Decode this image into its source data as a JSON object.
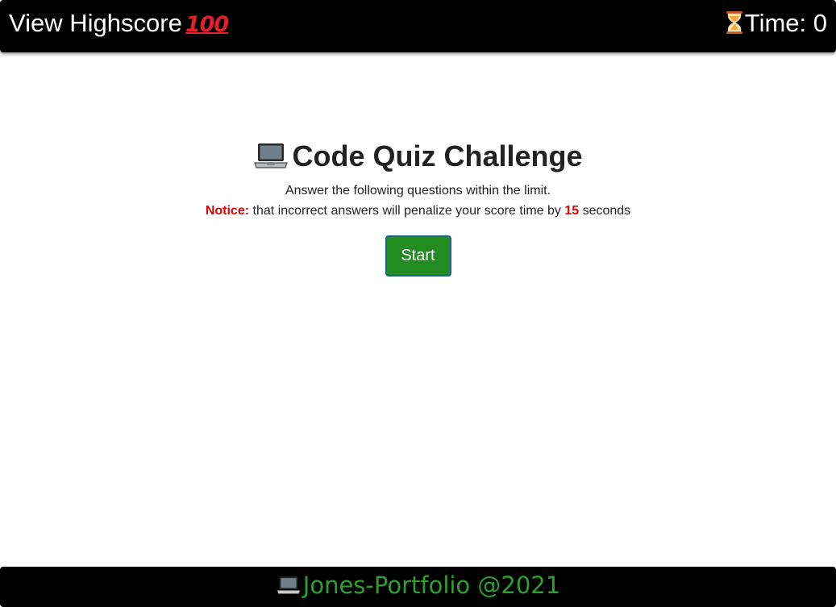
{
  "header": {
    "highscore_label": "View Highscore",
    "highscore_emoji": "100",
    "timer_label": "Time: 0"
  },
  "intro": {
    "title": "Code Quiz Challenge",
    "instruction": "Answer the following questions within the limit.",
    "notice_label": "Notice:",
    "notice_text": " that incorrect answers will penalize your score time by ",
    "penalty_value": "15",
    "notice_suffix": " seconds",
    "start_label": "Start"
  },
  "footer": {
    "text": "Jones-Portfolio @2021"
  },
  "icons": {
    "highscore": "hundred-points-icon",
    "timer": "hourglass-icon",
    "title": "laptop-icon",
    "footer": "laptop-icon"
  },
  "colors": {
    "topbar_bg": "#000000",
    "notice_red": "#e00000",
    "start_button_green": "#228b22",
    "footer_text_green": "#2ca02c"
  }
}
